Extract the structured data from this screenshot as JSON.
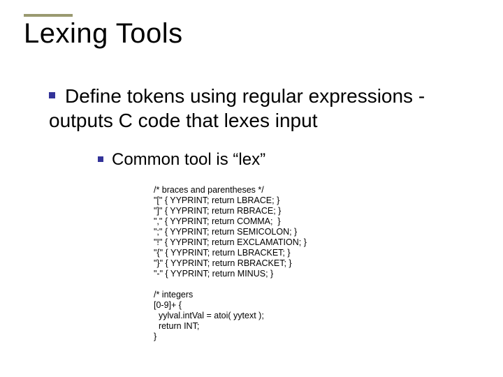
{
  "title": "Lexing Tools",
  "bullets": [
    {
      "text": "Define tokens using regular expressions - outputs C code that lexes input",
      "children": [
        {
          "text": "Common tool is “lex”"
        }
      ]
    }
  ],
  "code": "/* braces and parentheses */\n\"[\" { YYPRINT; return LBRACE; }\n\"]\" { YYPRINT; return RBRACE; }\n\",\" { YYPRINT; return COMMA;  }\n\";\" { YYPRINT; return SEMICOLON; }\n\"!\" { YYPRINT; return EXCLAMATION; }\n\"{\" { YYPRINT; return LBRACKET; }\n\"}\" { YYPRINT; return RBRACKET; }\n\"-\" { YYPRINT; return MINUS; }\n\n/* integers\n[0-9]+ {\n  yylval.intVal = atoi( yytext );\n  return INT;\n}"
}
